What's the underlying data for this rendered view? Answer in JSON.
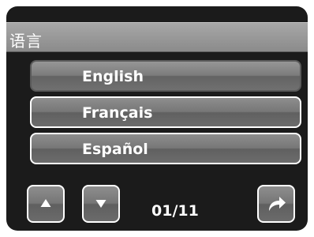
{
  "header": {
    "title": "语言"
  },
  "languages": [
    {
      "label": "English",
      "selected": true
    },
    {
      "label": "Français",
      "selected": false
    },
    {
      "label": "Español",
      "selected": false
    }
  ],
  "pager": {
    "indicator": "01/11"
  },
  "icons": {
    "up": "up-arrow-icon",
    "down": "down-arrow-icon",
    "exit": "exit-arrow-icon"
  }
}
